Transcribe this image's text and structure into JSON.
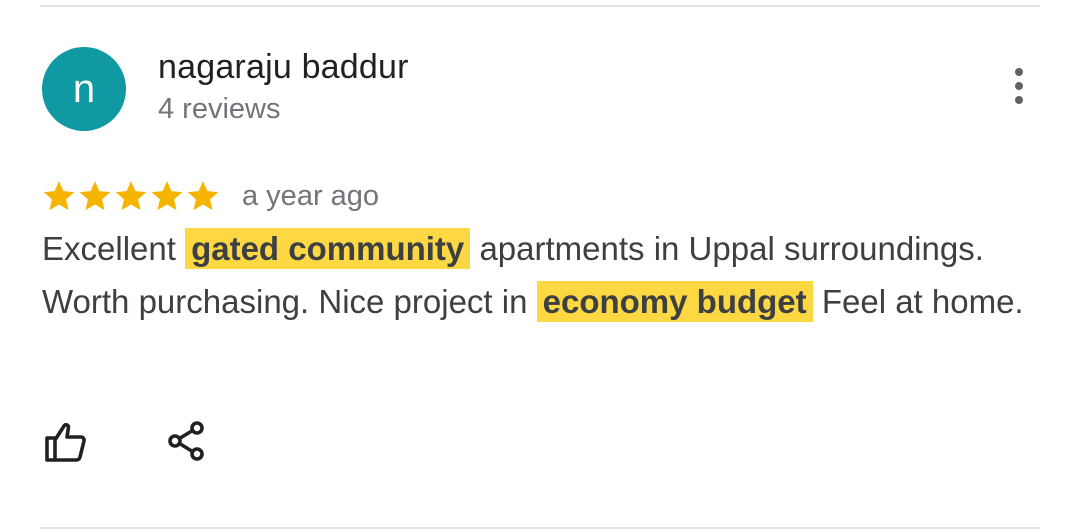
{
  "review": {
    "author": {
      "initial": "n",
      "name": "nagaraju baddur",
      "review_count": "4 reviews",
      "avatar_color": "#1098a3"
    },
    "rating": 5,
    "rating_max": 5,
    "star_color": "#f5b400",
    "date": "a year ago",
    "text": {
      "part1": "Excellent ",
      "highlight1": "gated community",
      "part2": " apartments in Uppal surroundings. Worth purchasing. Nice project in ",
      "highlight2": "economy budget",
      "part3": " Feel at home."
    },
    "highlight_color": "#fdd843"
  },
  "actions": {
    "more_icon": "more-vert-icon",
    "like_icon": "thumb-up-icon",
    "share_icon": "share-icon"
  }
}
